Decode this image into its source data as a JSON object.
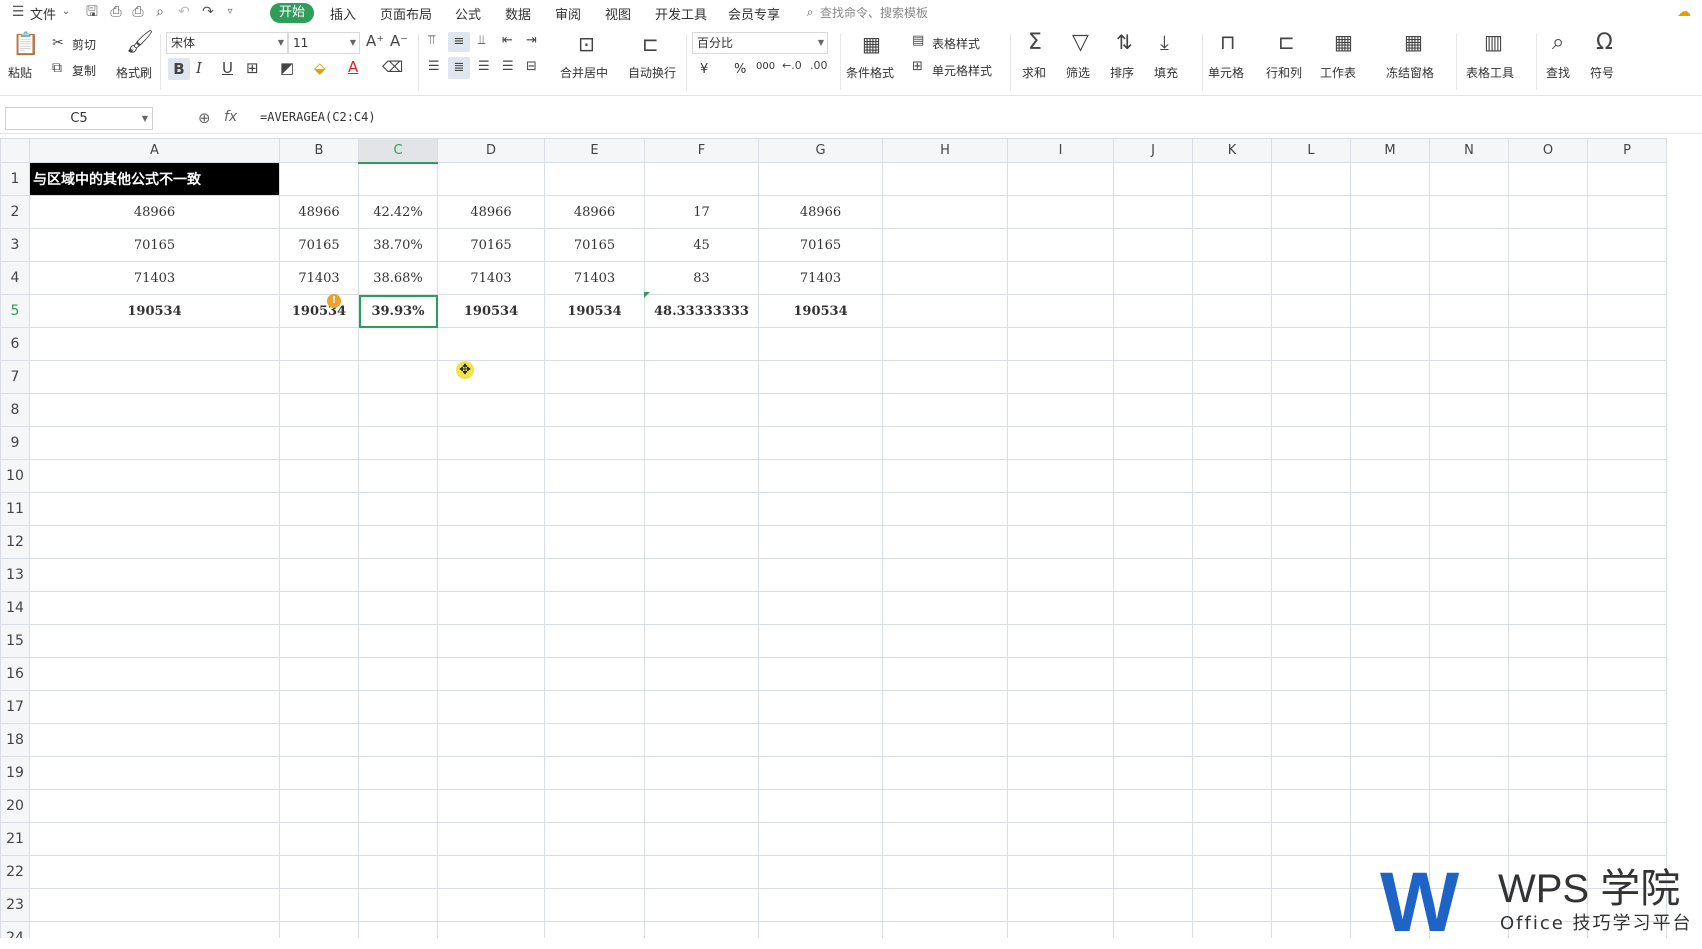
{
  "menu": {
    "file": "文件",
    "tabs": [
      "开始",
      "插入",
      "页面布局",
      "公式",
      "数据",
      "审阅",
      "视图",
      "开发工具",
      "会员专享"
    ],
    "search": "查找命令、搜索模板"
  },
  "ribbon": {
    "paste": "粘贴",
    "cut": "剪切",
    "copy": "复制",
    "format_painter": "格式刷",
    "font_name": "宋体",
    "font_size": "11",
    "merge_center": "合并居中",
    "wrap": "自动换行",
    "number_format": "百分比",
    "currency": "¥",
    "percent": "%",
    "thousands": "000",
    "cond_format": "条件格式",
    "table_style": "表格样式",
    "cell_style": "单元格样式",
    "sum": "求和",
    "filter": "筛选",
    "sort": "排序",
    "fill": "填充",
    "cell": "单元格",
    "row_col": "行和列",
    "sheet": "工作表",
    "freeze": "冻结窗格",
    "table_tools": "表格工具",
    "find": "查找",
    "symbol": "符号"
  },
  "formula_bar": {
    "name_box": "C5",
    "fx": "fx",
    "formula": "=AVERAGEA(C2:C4)"
  },
  "sheet": {
    "columns": [
      "A",
      "B",
      "C",
      "D",
      "E",
      "F",
      "G",
      "H",
      "I",
      "J",
      "K",
      "L",
      "M",
      "N",
      "O",
      "P"
    ],
    "rows": [
      [
        "与区域中的其他公式不一致",
        "",
        "",
        "",
        "",
        "",
        "",
        ""
      ],
      [
        "48966",
        "48966",
        "42.42%",
        "48966",
        "48966",
        "17",
        "48966",
        ""
      ],
      [
        "70165",
        "70165",
        "38.70%",
        "70165",
        "70165",
        "45",
        "70165",
        ""
      ],
      [
        "71403",
        "71403",
        "38.68%",
        "71403",
        "71403",
        "83",
        "71403",
        ""
      ],
      [
        "190534",
        "190534",
        "39.93%",
        "190534",
        "190534",
        "48.33333333",
        "190534",
        ""
      ]
    ],
    "row_count": 24,
    "active_cell": "C5"
  },
  "watermark": {
    "brand": "WPS 学院",
    "slogan": "Office 技巧学习平台"
  },
  "colors": {
    "accent": "#2f9d5a",
    "brand": "#1e63c6",
    "title_bg": "#000000"
  }
}
